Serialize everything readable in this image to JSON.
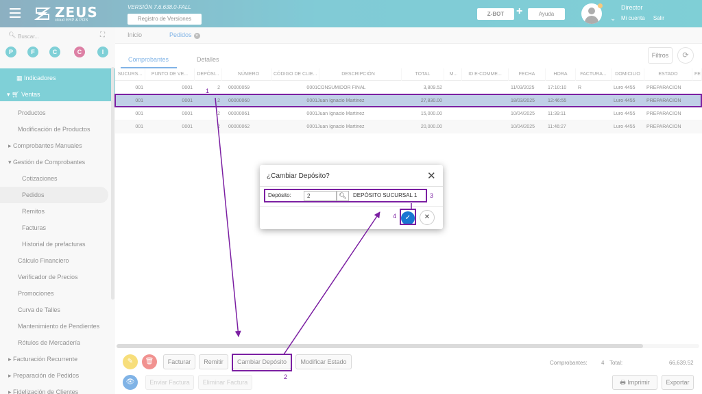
{
  "header": {
    "logo_text": "ZEUS",
    "logo_sub": "cloud ERP & POS",
    "version": "VERSIÓN 7.6.638.0-FALL",
    "registro_label": "Registro de Versiones",
    "zbot_label": "Z-BOT",
    "plus": "+",
    "ayuda_label": "Ayuda",
    "user_name": "Director",
    "mi_cuenta": "Mi cuenta",
    "salir": "Salir"
  },
  "sidebar": {
    "search_placeholder": "Buscar...",
    "shortcuts": [
      {
        "letter": "P",
        "color": "#16a9b6"
      },
      {
        "letter": "F",
        "color": "#16a9b6"
      },
      {
        "letter": "C",
        "color": "#16a9b6"
      },
      {
        "letter": "C",
        "color": "#c2185b"
      },
      {
        "letter": "I",
        "color": "#16a9b6"
      }
    ],
    "items": [
      {
        "label": "Indicadores",
        "icon": "grid-icon"
      },
      {
        "label": "Ventas",
        "icon": "cart-icon"
      },
      {
        "label": "Productos"
      },
      {
        "label": "Modificación de Productos"
      },
      {
        "label": "Comprobantes Manuales"
      },
      {
        "label": "Gestión de Comprobantes"
      },
      {
        "label": "Cotizaciones"
      },
      {
        "label": "Pedidos"
      },
      {
        "label": "Remitos"
      },
      {
        "label": "Facturas"
      },
      {
        "label": "Historial de prefacturas"
      },
      {
        "label": "Cálculo Financiero"
      },
      {
        "label": "Verificador de Precios"
      },
      {
        "label": "Promociones"
      },
      {
        "label": "Curva de Talles"
      },
      {
        "label": "Mantenimiento de Pendientes"
      },
      {
        "label": "Rótulos de Mercadería"
      },
      {
        "label": "Facturación Recurrente"
      },
      {
        "label": "Preparación de Pedidos"
      },
      {
        "label": "Fidelización de Clientes"
      }
    ]
  },
  "tabs": {
    "inicio": "Inicio",
    "pedidos": "Pedidos",
    "close": "×"
  },
  "subtabs": {
    "comprobantes": "Comprobantes",
    "detalles": "Detalles",
    "filtros": "Filtros",
    "refresh": "⟳"
  },
  "table": {
    "headers": [
      "SUCURS...",
      "PUNTO DE VE...",
      "DEPÓSI...",
      "NÚMERO",
      "CÓDIGO DE CLIE...",
      "DESCRIPCIÓN",
      "TOTAL",
      "M...",
      "ID E-COMME...",
      "FECHA",
      "HORA",
      "FACTURA...",
      "DOMICILIO",
      "ESTADO",
      "FE"
    ],
    "rows": [
      [
        "001",
        "0001",
        "2",
        "00000059",
        "0001",
        "CONSUMIDOR FINAL",
        "3,809.52",
        "",
        "",
        "11/03/2025",
        "17:10:10",
        "R",
        "Luro 4455",
        "PREPARACION",
        ""
      ],
      [
        "001",
        "0001",
        "2",
        "00000060",
        "0001",
        "Juan Ignacio Martinez",
        "27,830.00",
        "",
        "",
        "18/03/2025",
        "12:46:55",
        "",
        "Luro 4455",
        "PREPARACION",
        ""
      ],
      [
        "001",
        "0001",
        "2",
        "00000061",
        "0001",
        "Juan Ignacio Martinez",
        "15,000.00",
        "",
        "",
        "10/04/2025",
        "11:39:11",
        "",
        "Luro 4455",
        "PREPARACION",
        ""
      ],
      [
        "001",
        "0001",
        "2",
        "00000062",
        "0001",
        "Juan Ignacio Martinez",
        "20,000.00",
        "",
        "",
        "10/04/2025",
        "11:46:27",
        "",
        "Luro 4455",
        "PREPARACION",
        ""
      ]
    ]
  },
  "toolbar": {
    "facturar": "Facturar",
    "remitir": "Remitir",
    "cambiar_deposito": "Cambiar Depósito",
    "modificar_estado": "Modificar Estado",
    "enviar_factura": "Enviar Factura",
    "eliminar_factura": "Eliminar Factura",
    "imprimir": "Imprimir",
    "exportar": "Exportar",
    "comprobantes_label": "Comprobantes:",
    "comprobantes_count": "4",
    "total_label": "Total:",
    "total_value": "66,639.52"
  },
  "dialog": {
    "title": "¿Cambiar Depósito?",
    "deposito_label": "Depósito:",
    "deposito_value": "2",
    "deposito_name": "DEPÓSITO SUCURSAL 1",
    "ok": "✓",
    "cancel": "✕",
    "close": "✕"
  },
  "annotations": [
    "1",
    "2",
    "3",
    "4"
  ],
  "colors": {
    "accent": "#16a9b6",
    "selected_row": "#8ca8d4",
    "annotation": "#7b1fa2",
    "primary": "#1976d2"
  }
}
